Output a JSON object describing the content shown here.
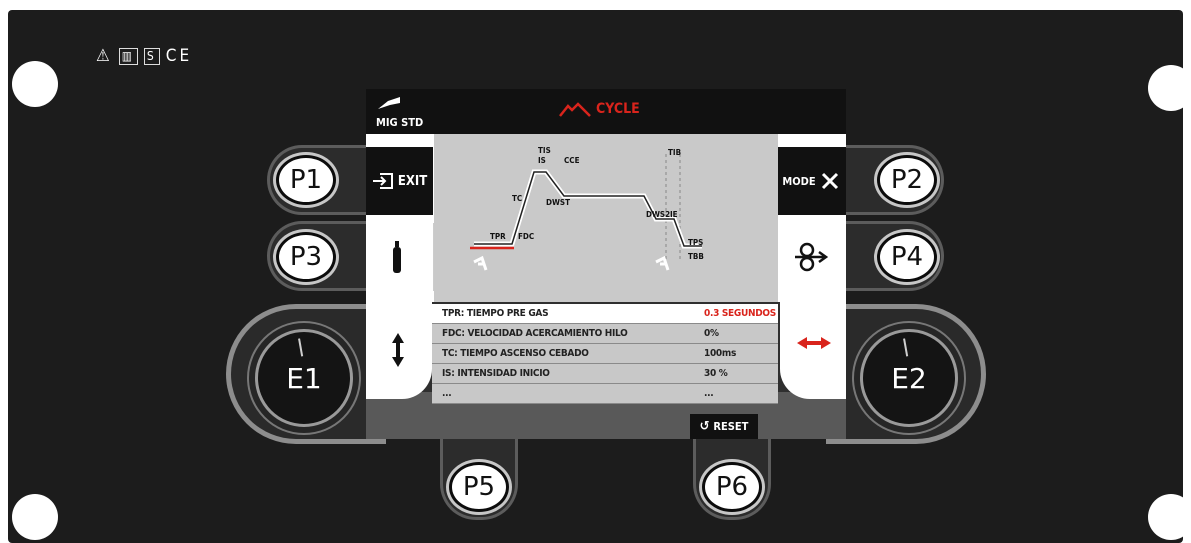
{
  "panel": {
    "symbols": [
      "⚠",
      "▥",
      "S",
      "CE"
    ]
  },
  "buttons": {
    "p1": "P1",
    "p2": "P2",
    "p3": "P3",
    "p4": "P4",
    "p5": "P5",
    "p6": "P6",
    "e1": "E1",
    "e2": "E2"
  },
  "screen": {
    "mode": "MIG STD",
    "cycle": "CYCLE",
    "exit": "EXIT",
    "mode_label": "MODE",
    "reset": "RESET",
    "graph_labels": {
      "tis": "TIS",
      "is": "IS",
      "cce": "CCE",
      "tc": "TC",
      "dwst": "DWST",
      "tpr": "TPR",
      "fdc": "FDC",
      "tib": "TIB",
      "dws2": "DWS2",
      "ie": "IE",
      "tps": "TPS",
      "tbb": "TBB"
    },
    "params": [
      {
        "name": "TPR: TIEMPO PRE GAS",
        "value": "0.3 SEGUNDOS"
      },
      {
        "name": "FDC: VELOCIDAD ACERCAMIENTO HILO",
        "value": "0%"
      },
      {
        "name": "TC: TIEMPO ASCENSO CEBADO",
        "value": "100ms"
      },
      {
        "name": "IS: INTENSIDAD INICIO",
        "value": "30 %"
      },
      {
        "name": "...",
        "value": "..."
      }
    ]
  },
  "colors": {
    "accent_red": "#d9241c",
    "panel": "#1c1c1c",
    "graph_bg": "#c9c9c9"
  }
}
